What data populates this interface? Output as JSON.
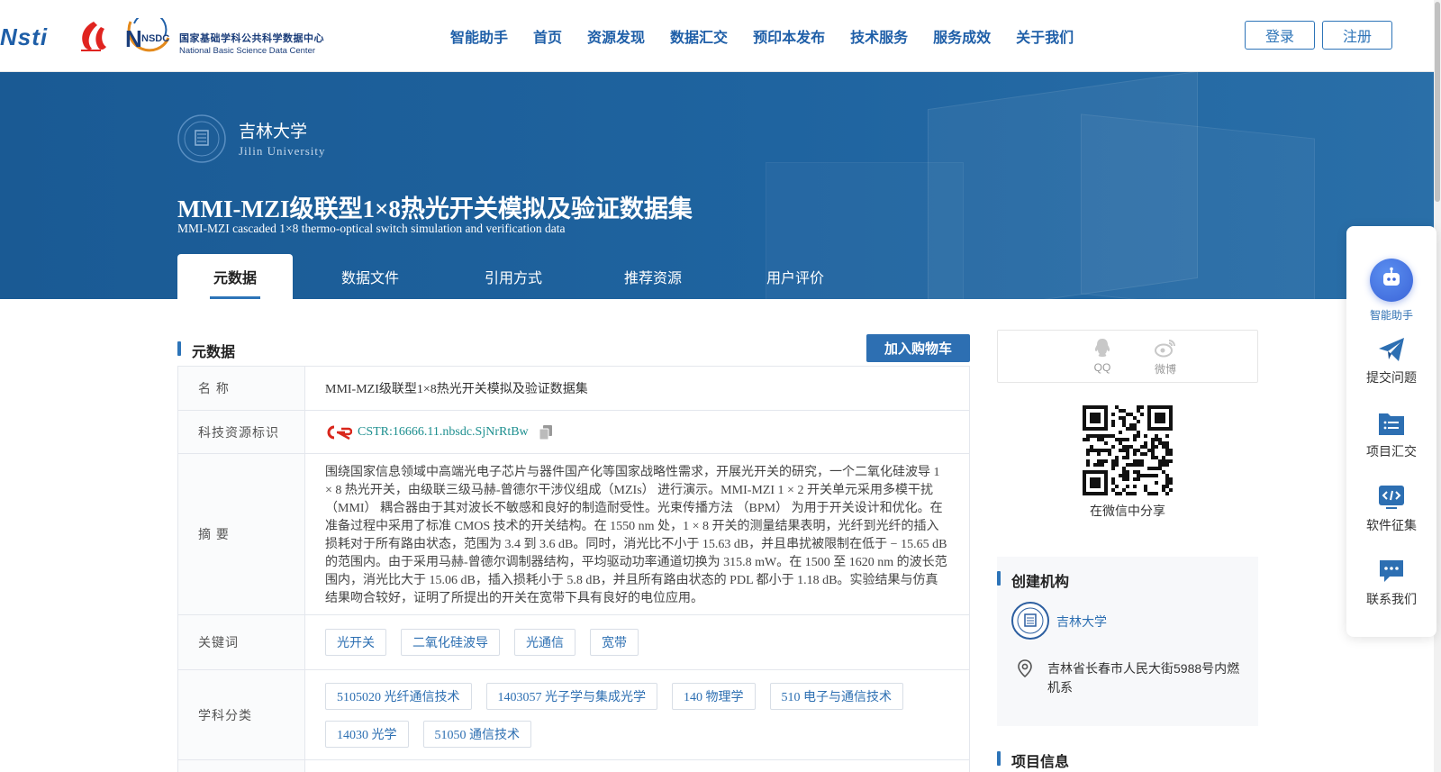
{
  "header": {
    "logos": {
      "nstl": "Nsti",
      "nsdc_badge": "NSDC",
      "nsdc_cn": "国家基础学科公共科学数据中心",
      "nsdc_en": "National Basic Science Data Center"
    },
    "nav": [
      "智能助手",
      "首页",
      "资源发现",
      "数据汇交",
      "预印本发布",
      "技术服务",
      "服务成效",
      "关于我们"
    ],
    "login": "登录",
    "register": "注册"
  },
  "hero": {
    "institution_cn": "吉林大学",
    "institution_en": "Jilin University",
    "title_cn": "MMI-MZI级联型1×8热光开关模拟及验证数据集",
    "title_en": "MMI-MZI cascaded 1×8 thermo-optical switch simulation and verification data",
    "tabs": [
      "元数据",
      "数据文件",
      "引用方式",
      "推荐资源",
      "用户评价"
    ],
    "active_tab": "元数据"
  },
  "metadata": {
    "section_title": "元数据",
    "cart_button": "加入购物车",
    "rows": {
      "name_label": "名 称",
      "name_value": "MMI-MZI级联型1×8热光开关模拟及验证数据集",
      "id_label": "科技资源标识",
      "id_value": "CSTR:16666.11.nbsdc.SjNrRtBw",
      "abstract_label": "摘 要",
      "abstract_value": "围绕国家信息领域中高端光电子芯片与器件国产化等国家战略性需求，开展光开关的研究，一个二氧化硅波导 1 × 8 热光开关，由级联三级马赫-曾德尔干涉仪组成（MZIs） 进行演示。MMI-MZI 1 × 2 开关单元采用多模干扰（MMI） 耦合器由于其对波长不敏感和良好的制造耐受性。光束传播方法 （BPM） 为用于开关设计和优化。在准备过程中采用了标准 CMOS 技术的开关结构。在 1550 nm 处，1 × 8 开关的测量结果表明，光纤到光纤的插入损耗对于所有路由状态，范围为 3.4 到 3.6 dB。同时，消光比不小于 15.63 dB，并且串扰被限制在低于 − 15.65 dB 的范围内。由于采用马赫-曾德尔调制器结构，平均驱动功率通道切换为 315.8 mW。在 1500 至 1620 nm 的波长范围内，消光比大于 15.06 dB，插入损耗小于 5.8 dB，并且所有路由状态的 PDL 都小于 1.18 dB。实验结果与仿真结果吻合较好，证明了所提出的开关在宽带下具有良好的电位应用。",
      "keywords_label": "关键词",
      "keywords": [
        "光开关",
        "二氧化硅波导",
        "光通信",
        "宽带"
      ],
      "subjects_label": "学科分类",
      "subjects": [
        "5105020 光纤通信技术",
        "1403057 光子学与集成光学",
        "140 物理学",
        "510 电子与通信技术",
        "14030 光学",
        "51050 通信技术"
      ]
    }
  },
  "sidebar": {
    "share": {
      "qq": "QQ",
      "weibo": "微博",
      "wechat_label": "在微信中分享"
    },
    "org": {
      "title": "创建机构",
      "name": "吉林大学",
      "address": "吉林省长春市人民大街5988号内燃机系"
    },
    "project_title": "项目信息"
  },
  "float_bar": {
    "items": [
      "智能助手",
      "提交问题",
      "项目汇交",
      "软件征集",
      "联系我们"
    ]
  },
  "colors": {
    "primary": "#2d6fb2",
    "hero": "#1f64a0",
    "link_teal": "#1d8f8f",
    "cstr_red": "#d9271c"
  }
}
